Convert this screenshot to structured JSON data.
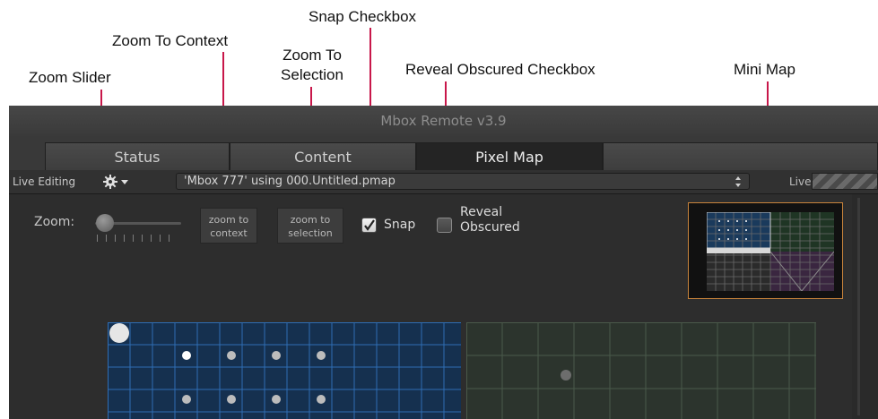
{
  "callouts": {
    "snap_checkbox": "Snap Checkbox",
    "zoom_to_context": "Zoom To Context",
    "zoom_to_selection_line1": "Zoom To",
    "zoom_to_selection_line2": "Selection",
    "reveal_obscured_checkbox": "Reveal Obscured Checkbox",
    "mini_map": "Mini Map",
    "zoom_slider": "Zoom Slider"
  },
  "window": {
    "title": "Mbox Remote v3.9"
  },
  "tabs": [
    {
      "label": "Status",
      "active": false
    },
    {
      "label": "Content",
      "active": false
    },
    {
      "label": "Pixel Map",
      "active": true
    }
  ],
  "toolbar": {
    "live_editing_label": "Live Editing",
    "gear_icon": "gear-icon",
    "file_value": "'Mbox 777' using 000.Untitled.pmap",
    "live_label": "Live"
  },
  "canvas_controls": {
    "zoom_label": "Zoom:",
    "zoom_level": 0.0,
    "zoom_to_context_line1": "zoom to",
    "zoom_to_context_line2": "context",
    "zoom_to_selection_line1": "zoom to",
    "zoom_to_selection_line2": "selection",
    "snap_label": "Snap",
    "snap_checked": true,
    "reveal_line1": "Reveal",
    "reveal_line2": "Obscured",
    "reveal_checked": false
  },
  "colors": {
    "callout_line": "#c8174a",
    "selected_grid_fill": "#15304f",
    "selected_grid_line": "#2f6db3",
    "unselected_grid_fill": "#2c342d",
    "unselected_grid_line": "#4a5a4a",
    "minimap_border": "#c8843b"
  }
}
